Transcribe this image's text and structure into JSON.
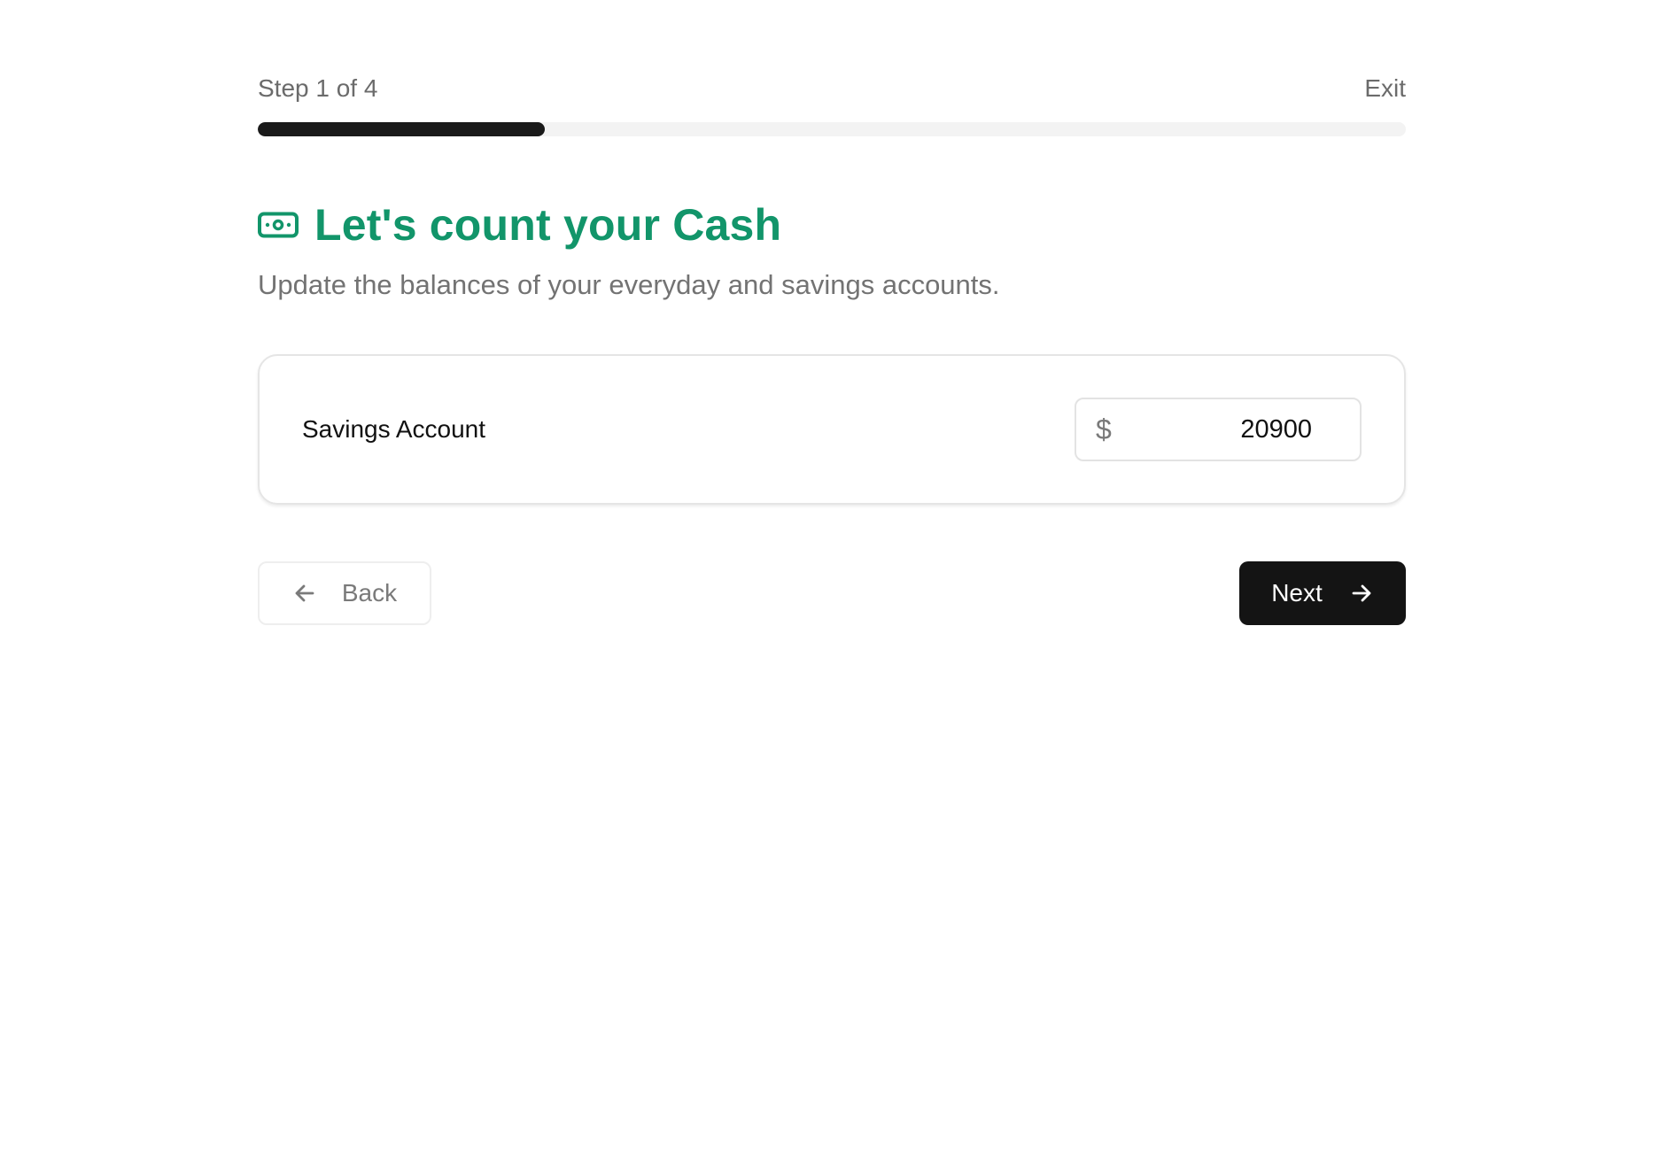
{
  "header": {
    "step_label": "Step 1 of 4",
    "exit_label": "Exit",
    "progress_fraction": 0.25
  },
  "intro": {
    "icon": "cash-icon",
    "title": "Let's count your Cash",
    "subtitle": "Update the balances of your everyday and savings accounts."
  },
  "accounts": [
    {
      "label": "Savings Account",
      "currency_symbol": "$",
      "value": "20900"
    }
  ],
  "navigation": {
    "back_label": "Back",
    "back_icon": "arrow-left-icon",
    "next_label": "Next",
    "next_icon": "arrow-right-icon"
  },
  "colors": {
    "accent": "#12956a",
    "primary_button": "#141414",
    "progress_fill": "#1a1a1a",
    "progress_track": "#f3f3f3",
    "muted_text": "#737373"
  }
}
